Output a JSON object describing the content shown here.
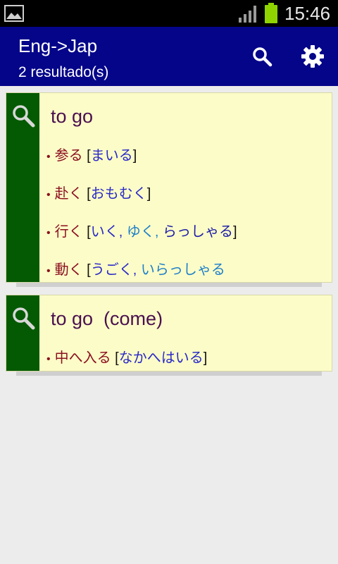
{
  "status_bar": {
    "time": "15:46",
    "icons": [
      "image-thumbnail-icon",
      "signal-icon",
      "battery-icon"
    ]
  },
  "app_bar": {
    "title": "Eng->Jap",
    "subtitle": "2 resultado(s)",
    "actions": [
      "search-icon",
      "gear-icon"
    ],
    "background": "#05058a"
  },
  "results": [
    {
      "word": "to go",
      "entries": [
        {
          "kanji": "参る",
          "readings": [
            "まいる"
          ]
        },
        {
          "kanji": "赴く",
          "readings": [
            "おもむく"
          ]
        },
        {
          "kanji": "行く",
          "readings": [
            "いく",
            "ゆく",
            "らっしゃる"
          ]
        },
        {
          "kanji": "動く",
          "readings": [
            "うごく",
            "いらっしゃる"
          ]
        }
      ]
    },
    {
      "word": "to go  (come)",
      "entries": [
        {
          "kanji": "中へ入る",
          "readings": [
            "なかへはいる"
          ]
        }
      ]
    }
  ],
  "colors": {
    "card_bg": "#fcfcc8",
    "card_side": "#035a03",
    "word": "#4a1050",
    "kanji": "#8b1020",
    "reading_1": "#2a2ac8",
    "reading_2": "#1f80c8"
  }
}
